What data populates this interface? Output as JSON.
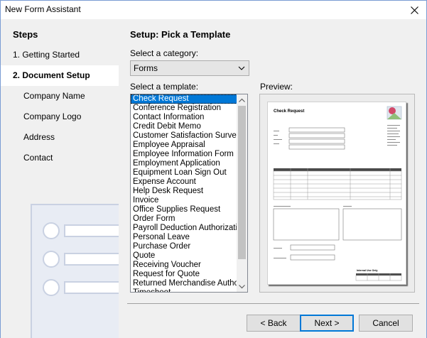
{
  "window": {
    "title": "New Form Assistant"
  },
  "sidebar": {
    "title": "Steps",
    "steps": [
      {
        "label": "1. Getting Started",
        "active": false
      },
      {
        "label": "2. Document Setup",
        "active": true
      },
      {
        "label": "Company Name",
        "active": false
      },
      {
        "label": "Company Logo",
        "active": false
      },
      {
        "label": "Address",
        "active": false
      },
      {
        "label": "Contact",
        "active": false
      }
    ]
  },
  "main": {
    "heading": "Setup: Pick a Template",
    "category_label": "Select a category:",
    "category_value": "Forms",
    "template_label": "Select a template:",
    "preview_label": "Preview:",
    "templates": [
      "Check Request",
      "Conference Registration",
      "Contact Information",
      "Credit Debit Memo",
      "Customer Satisfaction Survey",
      "Employee Appraisal",
      "Employee Information Form",
      "Employment Application",
      "Equipment Loan Sign Out",
      "Expense Account",
      "Help Desk Request",
      "Invoice",
      "Office Supplies Request",
      "Order Form",
      "Payroll Deduction Authorization",
      "Personal Leave",
      "Purchase Order",
      "Quote",
      "Receiving Voucher",
      "Request for Quote",
      "Returned Merchandise Authorization",
      "Timesheet"
    ],
    "selected_template": 0,
    "preview": {
      "doc_title": "Check Request",
      "footer_title": "Internal Use Only"
    }
  },
  "buttons": {
    "back": "< Back",
    "next": "Next >",
    "cancel": "Cancel"
  },
  "colors": {
    "selection": "#0078d7",
    "panel": "#f0f0f0",
    "accent_photo": "#d24a6a"
  }
}
